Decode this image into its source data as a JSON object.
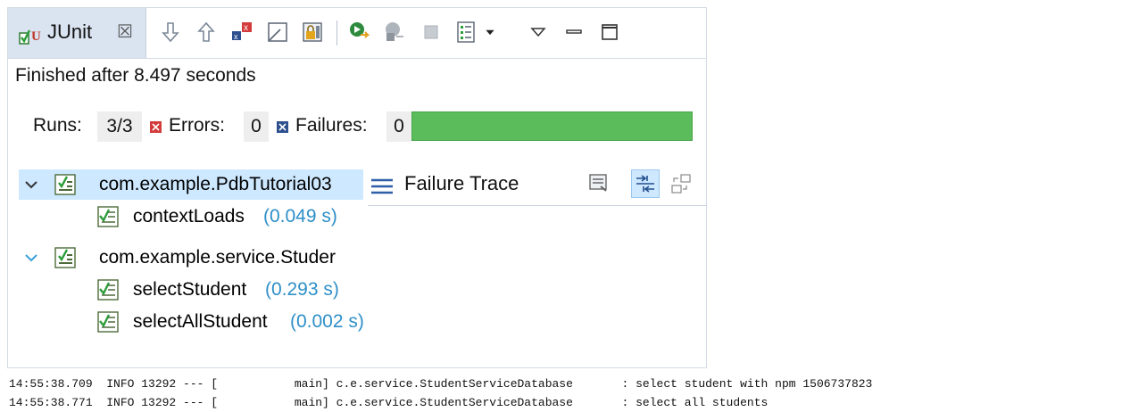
{
  "tab": {
    "label": "JUnit",
    "close": "☒"
  },
  "status": {
    "finished": "Finished after 8.497 seconds"
  },
  "stats": {
    "runs_label": "Runs:",
    "runs_value": "3/3",
    "errors_label": "Errors:",
    "errors_value": "0",
    "failures_label": "Failures:",
    "failures_value": "0",
    "progress_fraction": 1.0,
    "progress_color": "#5bbc5b"
  },
  "tree": {
    "suites": [
      {
        "name": "com.example.PdbTutorial03",
        "tests": [
          {
            "name": "contextLoads",
            "time": "(0.049 s)"
          }
        ]
      },
      {
        "name": "com.example.service.Studer",
        "tests": [
          {
            "name": "selectStudent",
            "time": "(0.293 s)"
          },
          {
            "name": "selectAllStudent",
            "time": "(0.002 s)"
          }
        ]
      }
    ]
  },
  "trace": {
    "title": "Failure Trace"
  },
  "console": {
    "lines": [
      "14:55:38.709  INFO 13292 --- [           main] c.e.service.StudentServiceDatabase       : select student with npm 1506737823",
      "14:55:38.771  INFO 13292 --- [           main] c.e.service.StudentServiceDatabase       : select all students"
    ]
  },
  "icons": {
    "tab": "junit-icon",
    "toolbar": [
      "next-failure-icon",
      "previous-failure-icon",
      "show-failures-only-icon",
      "scroll-lock-icon",
      "lock-icon",
      "rerun-test-icon",
      "rerun-failed-first-icon",
      "stop-icon",
      "test-run-history-icon",
      "history-dropdown-icon",
      "view-menu-icon",
      "minimize-icon",
      "maximize-icon"
    ],
    "trace": [
      "compare-results-icon",
      "filter-stack-trace-icon",
      "copy-trace-icon"
    ]
  }
}
